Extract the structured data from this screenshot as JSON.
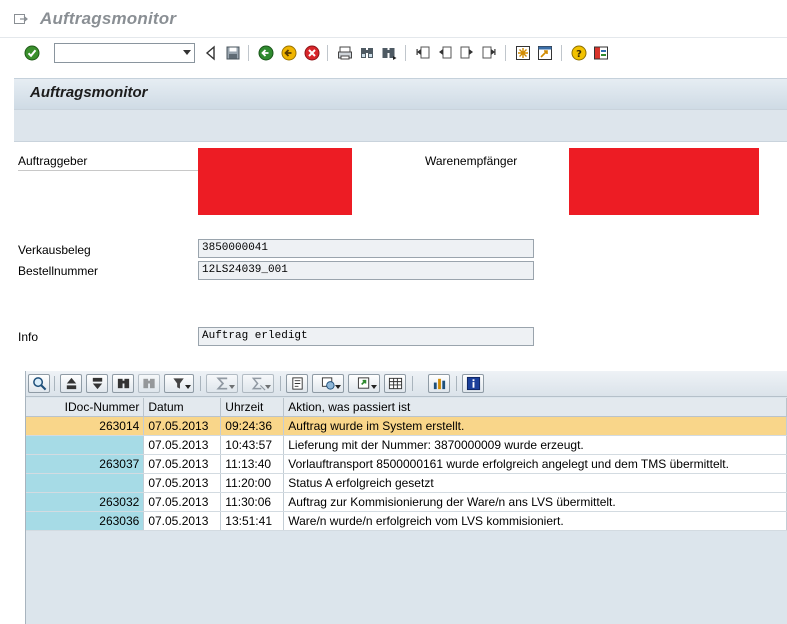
{
  "window": {
    "title": "Auftragsmonitor"
  },
  "toolbar": {
    "command_field_value": "",
    "icons": [
      "enter-check-icon",
      "back-icon",
      "save-icon",
      "green-back-icon",
      "exit-icon",
      "cancel-icon",
      "print-icon",
      "find-icon",
      "find-next-icon",
      "first-page-icon",
      "previous-page-icon",
      "next-page-icon",
      "last-page-icon",
      "create-session-icon",
      "shortcut-icon",
      "help-icon",
      "layout-icon"
    ]
  },
  "page": {
    "title": "Auftragsmonitor"
  },
  "form": {
    "auftraggeber_label": "Auftraggeber",
    "warenempfaenger_label": "Warenempfänger",
    "verkaufsbeleg_label": "Verkausbeleg",
    "verkaufsbeleg_value": "3850000041",
    "bestellnummer_label": "Bestellnummer",
    "bestellnummer_value": "12LS24039_001",
    "info_label": "Info",
    "info_value": "Auftrag erledigt"
  },
  "grid": {
    "columns": [
      "IDoc-Nummer",
      "Datum",
      "Uhrzeit",
      "Aktion, was passiert ist"
    ],
    "rows": [
      {
        "idoc": "263014",
        "datum": "07.05.2013",
        "uhrzeit": "09:24:36",
        "aktion": "Auftrag wurde im System erstellt."
      },
      {
        "idoc": "",
        "datum": "07.05.2013",
        "uhrzeit": "10:43:57",
        "aktion": "Lieferung mit der Nummer: 3870000009 wurde erzeugt."
      },
      {
        "idoc": "263037",
        "datum": "07.05.2013",
        "uhrzeit": "11:13:40",
        "aktion": "Vorlauftransport 8500000161 wurde erfolgreich angelegt und dem TMS übermittelt."
      },
      {
        "idoc": "",
        "datum": "07.05.2013",
        "uhrzeit": "11:20:00",
        "aktion": "Status A erfolgreich gesetzt"
      },
      {
        "idoc": "263032",
        "datum": "07.05.2013",
        "uhrzeit": "11:30:06",
        "aktion": "Auftrag zur Kommisionierung der Ware/n ans LVS übermittelt."
      },
      {
        "idoc": "263036",
        "datum": "07.05.2013",
        "uhrzeit": "13:51:41",
        "aktion": "Ware/n wurde/n erfolgreich vom LVS kommisioniert."
      }
    ]
  },
  "colors": {
    "selected_row": "#f9d68a",
    "key_column": "#a6dbe6",
    "redaction": "#ed1c24"
  }
}
